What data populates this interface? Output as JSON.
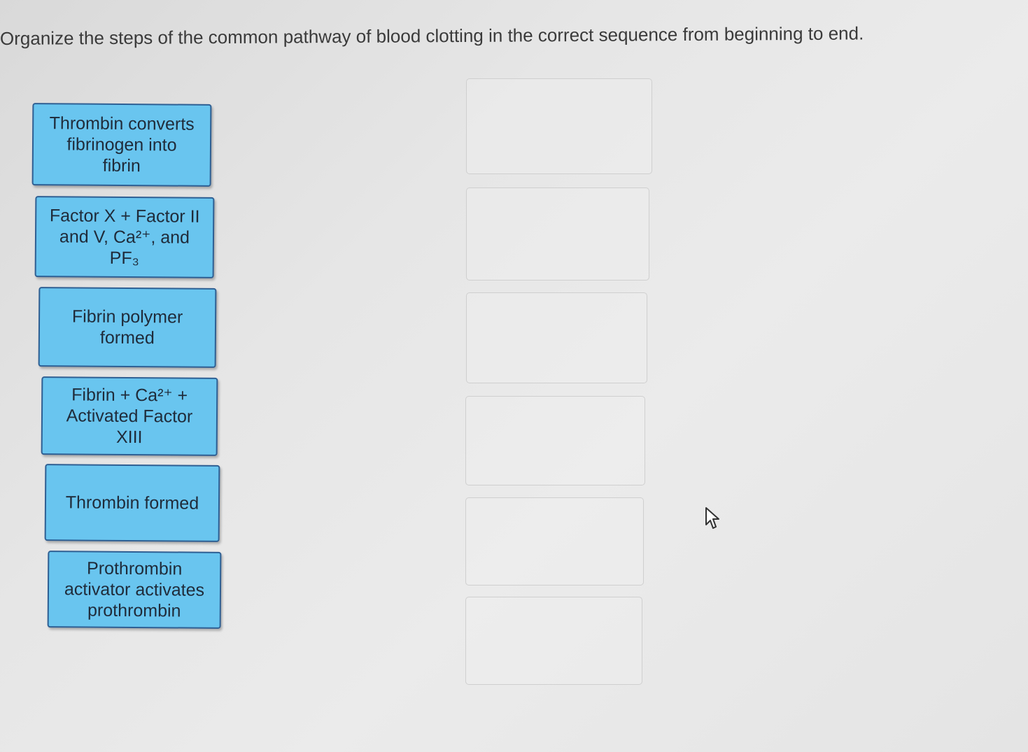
{
  "instruction": "Organize the steps of the common pathway of blood clotting in the correct sequence from beginning to end.",
  "cards": [
    {
      "label": "Thrombin converts\nfibrinogen into\nfibrin"
    },
    {
      "label": "Factor X + Factor II\nand V, Ca²⁺, and\nPF₃"
    },
    {
      "label": "Fibrin polymer\nformed"
    },
    {
      "label": "Fibrin + Ca²⁺ +\nActivated Factor\nXIII"
    },
    {
      "label": "Thrombin formed"
    },
    {
      "label": "Prothrombin\nactivator activates\nprothrombin"
    }
  ],
  "drop_slots": [
    {
      "value": ""
    },
    {
      "value": ""
    },
    {
      "value": ""
    },
    {
      "value": ""
    },
    {
      "value": ""
    },
    {
      "value": ""
    }
  ],
  "colors": {
    "card_fill": "#69c5ef",
    "card_border": "#2e5f93",
    "slot_border": "#cfcfcf",
    "text": "#3a3a3a"
  },
  "icons": {
    "cursor": "pointer-cursor-icon"
  }
}
